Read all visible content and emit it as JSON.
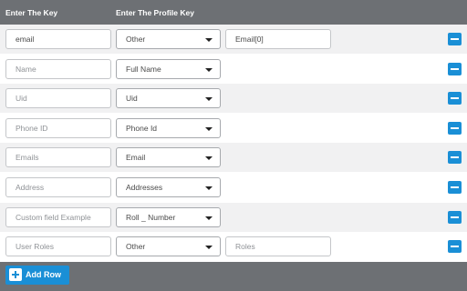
{
  "header": {
    "key_column": "Enter The Key",
    "profile_column": "Enter The Profile Key"
  },
  "rows": [
    {
      "key": "email",
      "key_is_placeholder": false,
      "profile": "Other",
      "extra": "Email[0]",
      "extra_is_placeholder": false
    },
    {
      "key": "Name",
      "key_is_placeholder": true,
      "profile": "Full Name"
    },
    {
      "key": "Uid",
      "key_is_placeholder": true,
      "profile": "Uid"
    },
    {
      "key": "Phone ID",
      "key_is_placeholder": true,
      "profile": "Phone Id"
    },
    {
      "key": "Emails",
      "key_is_placeholder": true,
      "profile": "Email"
    },
    {
      "key": "Address",
      "key_is_placeholder": true,
      "profile": "Addresses"
    },
    {
      "key": "Custom field Example",
      "key_is_placeholder": true,
      "profile": "Roll _ Number"
    },
    {
      "key": "User Roles",
      "key_is_placeholder": true,
      "profile": "Other",
      "extra": "Roles",
      "extra_is_placeholder": true
    }
  ],
  "footer": {
    "add_row_label": "Add Row"
  },
  "icons": {
    "remove": "minus-icon",
    "add": "plus-icon",
    "dropdown": "chevron-down-icon"
  },
  "colors": {
    "header_bg": "#6d7074",
    "accent": "#1a8fd6",
    "alt_row_bg": "#f1f1f2"
  }
}
